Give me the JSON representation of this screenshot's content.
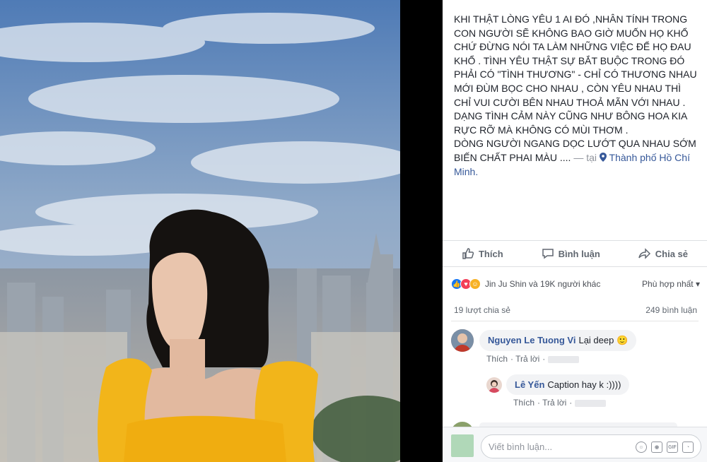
{
  "post": {
    "caption": "KHI THẬT LÒNG YÊU 1 AI ĐÓ ,NHÂN TÍNH TRONG CON NGƯỜI SẼ KHÔNG BAO GIỜ MUỐN HỌ KHỔ CHỨ ĐỪNG NÓI TA LÀM NHỮNG VIỆC ĐỂ HỌ ĐAU KHỔ . TÌNH YÊU THẬT SỰ BẮT BUỘC TRONG ĐÓ PHẢI CÓ \"TÌNH THƯƠNG\" - CHỈ CÓ THƯƠNG NHAU MỚI ĐÙM BỌC CHO NHAU , CÒN YÊU NHAU THÌ CHỈ VUI CƯỜI BÊN NHAU THOẢ MÃN VỚI NHAU . DẠNG TÌNH CẢM NÀY CŨNG NHƯ BÔNG HOA KIA RỰC RỠ MÀ KHÔNG CÓ MÙI THƠM .\nDÒNG NGƯỜI NGANG DỌC LƯỚT QUA NHAU SỚM BIẾN CHẤT PHAI MÀU ....",
    "location_prefix": " — tại",
    "location": "Thành phố Hồ Chí Minh."
  },
  "actions": {
    "like": "Thích",
    "comment": "Bình luận",
    "share": "Chia sẻ"
  },
  "reactions": {
    "summary": "Jin Ju Shin và 19K người khác",
    "sort_label": "Phù hợp nhất"
  },
  "counts": {
    "shares": "19 lượt chia sẻ",
    "comments": "249 bình luận"
  },
  "comments": [
    {
      "name": "Nguyen Le Tuong Vi",
      "text": "Lại deep",
      "emoji": "🙂",
      "like": "Thích",
      "reply": "Trả lời"
    },
    {
      "name": "Lê Yến",
      "text": "Caption hay k :))))",
      "like": "Thích",
      "reply": "Trả lời"
    }
  ],
  "composer": {
    "placeholder": "Viết bình luận..."
  },
  "colors": {
    "link": "#365899",
    "like_blue": "#1877f2",
    "love_red": "#f33e58",
    "haha_yellow": "#f7b125",
    "dress_yellow": "#f2b51a"
  },
  "icons": {
    "like": "thumbs-up-icon",
    "comment": "speech-bubble-icon",
    "share": "share-arrow-icon",
    "location": "map-pin-icon",
    "sort": "caret-down-icon"
  }
}
